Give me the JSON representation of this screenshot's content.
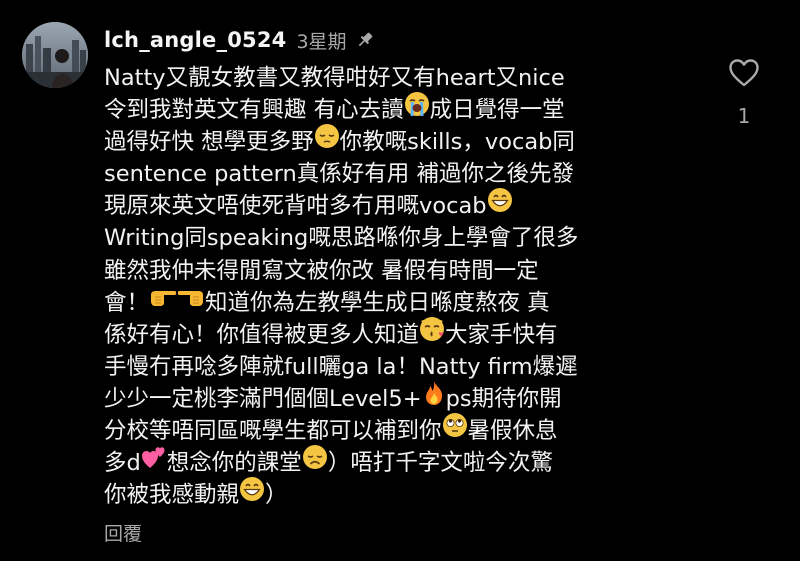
{
  "comment": {
    "username": "lch_angle_0524",
    "time": "3星期",
    "pin_icon": "pin-icon",
    "avatar_icon": "profile-photo",
    "lines": [
      [
        "Natty又靚女教書又教得咁好又有heart又nice"
      ],
      [
        "令到我對英文有興趣 有心去讀",
        {
          "emoji": "loudly-crying-face"
        },
        "成日覺得一堂"
      ],
      [
        "過得好快 想學更多野",
        {
          "emoji": "pensive-face"
        },
        "你教嘅skills，vocab同"
      ],
      [
        "sentence pattern真係好有用 補過你之後先發"
      ],
      [
        "現原來英文唔使死背咁多冇用嘅vocab",
        {
          "emoji": "grinning-face"
        }
      ],
      [
        "Writing同speaking嘅思路喺你身上學會了很多"
      ],
      [
        "雖然我仲未得閒寫文被你改 暑假有時間一定"
      ],
      [
        "會！",
        {
          "emoji": "backhand-index-pointing-right"
        },
        {
          "emoji": "backhand-index-pointing-left"
        },
        "知道你為左教學生成日喺度熬夜 真"
      ],
      [
        "係好有心！你值得被更多人知道",
        {
          "emoji": "kissing-cat"
        },
        "大家手快有"
      ],
      [
        "手慢冇再唸多陣就full曬ga la！Natty firm爆遲"
      ],
      [
        "少少一定桃李滿門個個Level5+",
        {
          "emoji": "fire"
        },
        "ps期待你開"
      ],
      [
        "分校等唔同區嘅學生都可以補到你",
        {
          "emoji": "face-with-rolling-eyes"
        },
        "暑假休息"
      ],
      [
        "多d",
        {
          "emoji": "two-hearts"
        },
        "想念你的課堂",
        {
          "emoji": "disappointed-face"
        },
        "）唔打千字文啦今次驚"
      ],
      [
        "你被我感動親",
        {
          "emoji": "grinning-face"
        },
        "）"
      ]
    ],
    "reply_label": "回覆",
    "like_icon": "heart-outline-icon",
    "like_count": "1"
  },
  "colors": {
    "background": "#000000",
    "text": "#f2f2f2",
    "muted": "#a8a8a8",
    "emoji_yellow": "#f4c542",
    "fire": "#ff7a1a",
    "heart_pink": "#ff5fa2"
  }
}
